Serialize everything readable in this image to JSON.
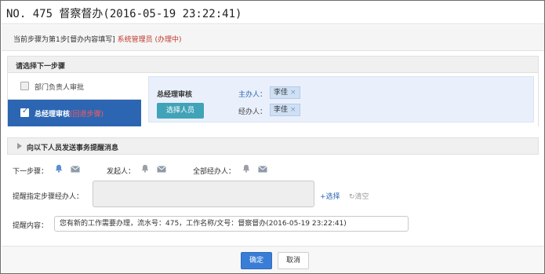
{
  "title": "NO. 475 督察督办(2016-05-19 23:22:41)",
  "current_step": {
    "prefix": "当前步骤为第1步[督办内容填写]",
    "status": "系统管理员 (办理中)"
  },
  "next_step_header": "请选择下一步骤",
  "steps": [
    {
      "label": "部门负责人审批",
      "tag": "",
      "checked": false
    },
    {
      "label": "总经理审核",
      "tag": "(回退步骤)",
      "checked": true
    }
  ],
  "selected_step": {
    "name": "总经理审核",
    "select_button": "选择人员",
    "host_label": "主办人：",
    "host_value": "李佳",
    "agent_label": "经办人：",
    "agent_value": "李佳",
    "remove_glyph": "×"
  },
  "notify": {
    "header": "向以下人员发送事务提醒消息",
    "next_step_label": "下一步骤：",
    "sponsor_label": "发起人：",
    "all_agents_label": "全部经办人：",
    "remind_agent_label": "提醒指定步骤经办人：",
    "select_link": "+选择",
    "clear_link": "清空",
    "content_label": "提醒内容：",
    "content_value": "您有新的工作需要办理，流水号：475，工作名称/文号：督察督办(2016-05-19 23:22:41)"
  },
  "footer": {
    "ok": "确定",
    "cancel": "取消"
  },
  "colors": {
    "accent_blue": "#2c66b3",
    "select_button_teal": "#41a3b8",
    "status_red": "#c0392b"
  }
}
